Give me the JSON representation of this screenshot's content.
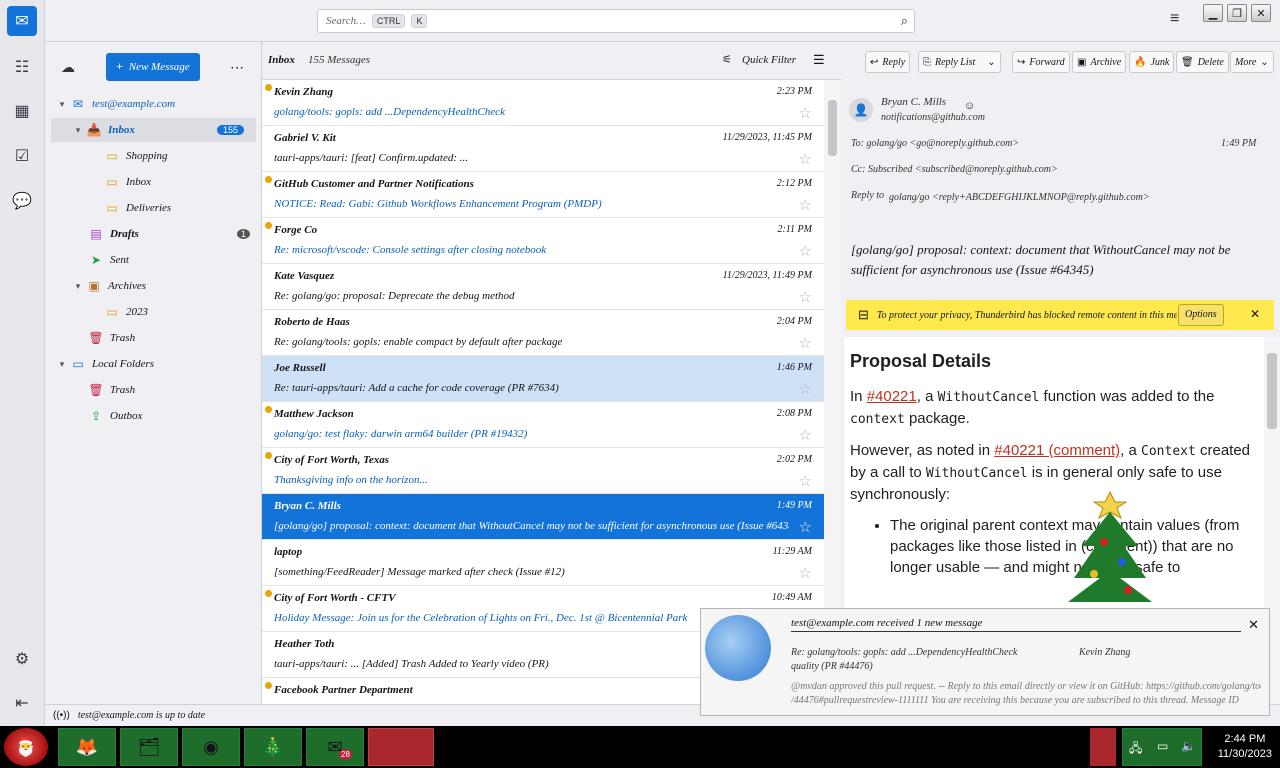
{
  "toolbar": {
    "search_placeholder": "Search…",
    "search_key1": "CTRL",
    "search_key2": "K"
  },
  "folders": {
    "new_message": "New Message",
    "account": "test@example.com",
    "items": [
      {
        "label": "Inbox",
        "badge": "155",
        "icon": "inbox-icon"
      },
      {
        "label": "Shopping",
        "icon": "folder-icon"
      },
      {
        "label": "Inbox",
        "icon": "folder-icon"
      },
      {
        "label": "Deliveries",
        "icon": "folder-icon"
      },
      {
        "label": "Drafts",
        "badge": "1",
        "icon": "drafts-icon"
      },
      {
        "label": "Sent",
        "icon": "sent-icon"
      },
      {
        "label": "Archives",
        "icon": "archive-icon"
      },
      {
        "label": "2023",
        "icon": "folder-icon"
      },
      {
        "label": "Trash",
        "icon": "trash-icon"
      },
      {
        "label": "Local Folders",
        "icon": "folder-icon"
      },
      {
        "label": "Trash",
        "icon": "trash-icon"
      },
      {
        "label": "Outbox",
        "icon": "outbox-icon"
      }
    ]
  },
  "list": {
    "header_title": "Inbox",
    "header_count": "155 Messages",
    "quick_filter": "Quick Filter",
    "messages": [
      {
        "from": "Kevin Zhang",
        "date": "2:23 PM",
        "subject": "golang/tools: gopls: add ...DependencyHealthCheck",
        "unread": true
      },
      {
        "from": "Gabriel V. Kit",
        "date": "11/29/2023, 11:45 PM",
        "subject": "tauri-apps/tauri: [feat] Confirm.updated: ...",
        "unread": false
      },
      {
        "from": "GitHub Customer and Partner Notifications",
        "date": "2:12 PM",
        "subject": "NOTICE: Read: Gabi: Github Workflows Enhancement Program (PMDP)",
        "unread": true
      },
      {
        "from": "Forge Co",
        "date": "2:11 PM",
        "subject": "Re: microsoft/vscode: Console settings after closing notebook",
        "unread": true
      },
      {
        "from": "Kate Vasquez",
        "date": "11/29/2023, 11:49 PM",
        "subject": "Re: golang/go: proposal: Deprecate the debug method",
        "unread": false
      },
      {
        "from": "Roberto de Haas",
        "date": "2:04 PM",
        "subject": "Re: golang/tools: gopls: enable compact by default after package",
        "unread": false
      },
      {
        "from": "Joe Russell",
        "date": "1:46 PM",
        "subject": "Re: tauri-apps/tauri: Add a cache for code coverage (PR #7634)",
        "unread": false
      },
      {
        "from": "Matthew Jackson",
        "date": "2:08 PM",
        "subject": "golang/go: test flaky: darwin arm64 builder (PR #19432)",
        "unread": true
      },
      {
        "from": "City of Fort Worth, Texas",
        "date": "2:02 PM",
        "subject": "Thanksgiving info on the horizon...",
        "unread": true
      },
      {
        "from": "Bryan C. Mills",
        "date": "1:49 PM",
        "subject": "[golang/go] proposal: context: document that WithoutCancel may not be sufficient for asynchronous use (Issue #64345)",
        "unread": false
      },
      {
        "from": "laptop",
        "date": "11:29 AM",
        "subject": "[something/FeedReader] Message marked after check (Issue #12)",
        "unread": false
      },
      {
        "from": "City of Fort Worth - CFTV",
        "date": "10:49 AM",
        "subject": "Holiday Message: Join us for the Celebration of Lights on Fri., Dec. 1st @ Bicentennial Park",
        "unread": true
      },
      {
        "from": "Heather Toth",
        "date": "",
        "subject": "tauri-apps/tauri: ... [Added] Trash Added to Yearly video (PR)",
        "unread": false
      },
      {
        "from": "Facebook Partner Department",
        "date": "",
        "subject": "",
        "unread": true
      }
    ]
  },
  "reader": {
    "buttons": [
      "Reply",
      "Reply List",
      "Forward",
      "Archive",
      "Junk",
      "Delete",
      "More"
    ],
    "from_name": "Bryan C. Mills",
    "from_addr": "notifications@github.com",
    "to": "To: golang/go <go@noreply.github.com>",
    "cc": "Cc: Subscribed <subscribed@noreply.github.com>",
    "reply_to_label": "Reply to",
    "reply_to": "golang/go <reply+ABCDEFGHIJKLMNOP@reply.github.com>",
    "time": "1:49 PM",
    "subject": "[golang/go] proposal: context: document that WithoutCancel may not be sufficient for asynchronous use (Issue #64345)",
    "notice": "To protect your privacy, Thunderbird has blocked remote content in this message.",
    "options": "Options",
    "body_title": "Proposal Details",
    "p1_a": "In ",
    "p1_link": "#40221",
    "p1_b": ", a ",
    "p1_code1": "WithoutCancel",
    "p1_c": " function was added to the ",
    "p1_code2": "context",
    "p1_d": " package.",
    "p2_a": "However, as noted in ",
    "p2_link": "#40221 (comment)",
    "p2_b": ", a ",
    "p2_code1": "Context",
    "p2_c": " created by a call to ",
    "p2_code2": "WithoutCancel",
    "p2_d": " is in general only safe to use synchronously:",
    "li1": "The original parent context may contain values (from packages like those listed in (comment)) that are no longer usable — and might not even safe to"
  },
  "status": {
    "text": "test@example.com is up to date"
  },
  "notification": {
    "title": "test@example.com received 1 new message",
    "line1": "Re: golang/tools: gopls: add ...DependencyHealthCheck",
    "line1b": "Kevin Zhang",
    "line2": "quality (PR #44476)",
    "line3": "@mvdan approved this pull request. -- Reply to this email directly or view it on GitHub: https://github.com/golang/tools/pull",
    "line4": "/44476#pullrequestreview-1111111 You are receiving this because you are subscribed to this thread. Message ID"
  },
  "taskbar": {
    "time": "2:44 PM",
    "date": "11/30/2023",
    "badge": "28"
  }
}
